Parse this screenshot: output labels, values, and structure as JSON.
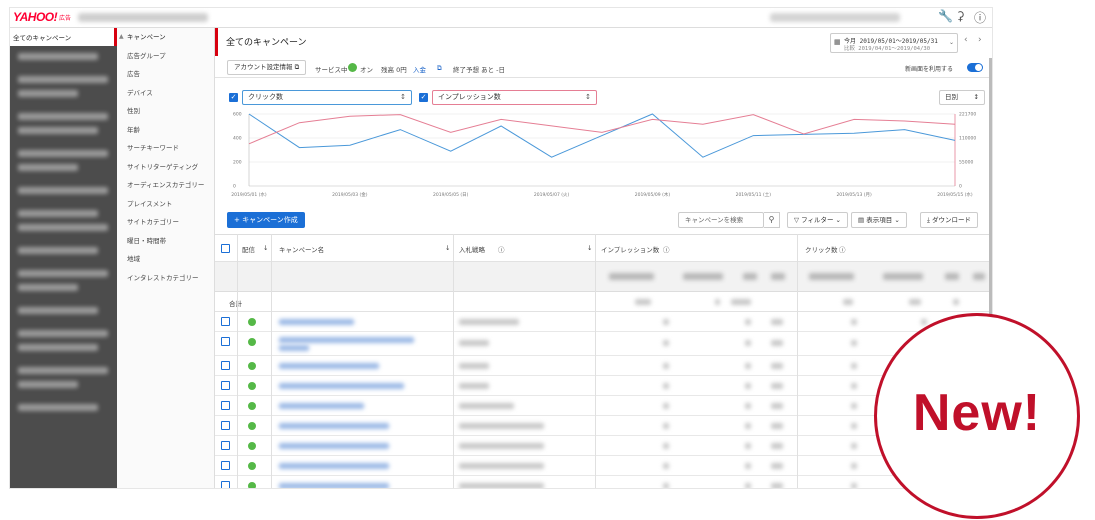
{
  "header": {
    "logo": "YAHOO!",
    "logo_sub": "広告",
    "icons": [
      "wrench-icon",
      "bell-icon",
      "help-icon"
    ]
  },
  "sidebar": {
    "heading": "全てのキャンペーン"
  },
  "subnav": {
    "items": [
      "キャンペーン",
      "広告グループ",
      "広告",
      "デバイス",
      "性別",
      "年齢",
      "サーチキーワード",
      "サイトリターゲティング",
      "オーディエンスカテゴリー",
      "プレイスメント",
      "サイトカテゴリー",
      "曜日・時間帯",
      "地域",
      "インタレストカテゴリー"
    ]
  },
  "page": {
    "title": "全てのキャンペーン",
    "date_range": "今月 2019/05/01〜2019/05/31",
    "date_compare": "比較 2019/04/01〜2019/04/30"
  },
  "status_bar": {
    "account_settings": "アカウント設定情報",
    "service_status": "サービス中",
    "on_label": "オン",
    "balance": "残高 0円",
    "deposit": "入金",
    "end_forecast": "終了予想 あと -日",
    "new_screen_label": "新画面を利用する",
    "new_screen_enabled": true
  },
  "metrics": {
    "left": "クリック数",
    "right": "インプレッション数",
    "granularity": "日別"
  },
  "chart_data": {
    "type": "line",
    "x": [
      "2019/05/01 (水)",
      "2019/05/03 (金)",
      "2019/05/05 (日)",
      "2019/05/07 (火)",
      "2019/05/09 (木)",
      "2019/05/11 (土)",
      "2019/05/13 (月)",
      "2019/05/15 (水)"
    ],
    "y_left_ticks": [
      "600",
      "400",
      "200",
      "0"
    ],
    "y_right_ticks": [
      "221700",
      "110000",
      "55000",
      "0"
    ],
    "ylim_left": [
      0,
      600
    ],
    "ylim_right": [
      0,
      221700
    ],
    "grid": true,
    "colors": {
      "clicks": "#4a98d9",
      "impressions": "#e57e94"
    },
    "series": [
      {
        "name": "クリック数",
        "axis": "left",
        "values": [
          600,
          320,
          340,
          470,
          290,
          500,
          240,
          420,
          600,
          240,
          420,
          430,
          440,
          470,
          380
        ]
      },
      {
        "name": "インプレッション数",
        "axis": "right",
        "values": [
          130000,
          195000,
          215000,
          220000,
          165000,
          205000,
          185000,
          165000,
          205000,
          190000,
          220000,
          160000,
          205000,
          200000,
          190000
        ]
      }
    ]
  },
  "toolbar": {
    "create_label": "+ キャンペーン作成",
    "search_placeholder": "キャンペーンを検索",
    "filter_label": "フィルター",
    "columns_label": "表示項目",
    "download_label": "ダウンロード"
  },
  "table": {
    "headers": {
      "delivery": "配信",
      "campaign_name": "キャンペーン名",
      "bid_strategy": "入札戦略",
      "impressions": "インプレッション数",
      "clicks": "クリック数"
    },
    "total_label": "合計"
  },
  "badge": {
    "text": "New!"
  }
}
